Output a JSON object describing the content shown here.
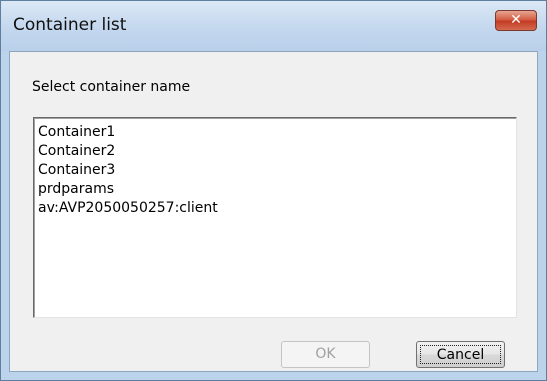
{
  "window": {
    "title": "Container list",
    "close_glyph": "✕",
    "close_icon": "close-icon"
  },
  "dialog": {
    "prompt": "Select container name",
    "items": [
      "Container1",
      "Container2",
      "Container3",
      "prdparams",
      "av:AVP2050050257:client"
    ]
  },
  "buttons": {
    "ok_label": "OK",
    "ok_enabled": false,
    "cancel_label": "Cancel",
    "cancel_focused": true
  },
  "colors": {
    "titlebar": "#c3d7ee",
    "close_button": "#c23a22",
    "client_background": "#f0f0f0"
  }
}
